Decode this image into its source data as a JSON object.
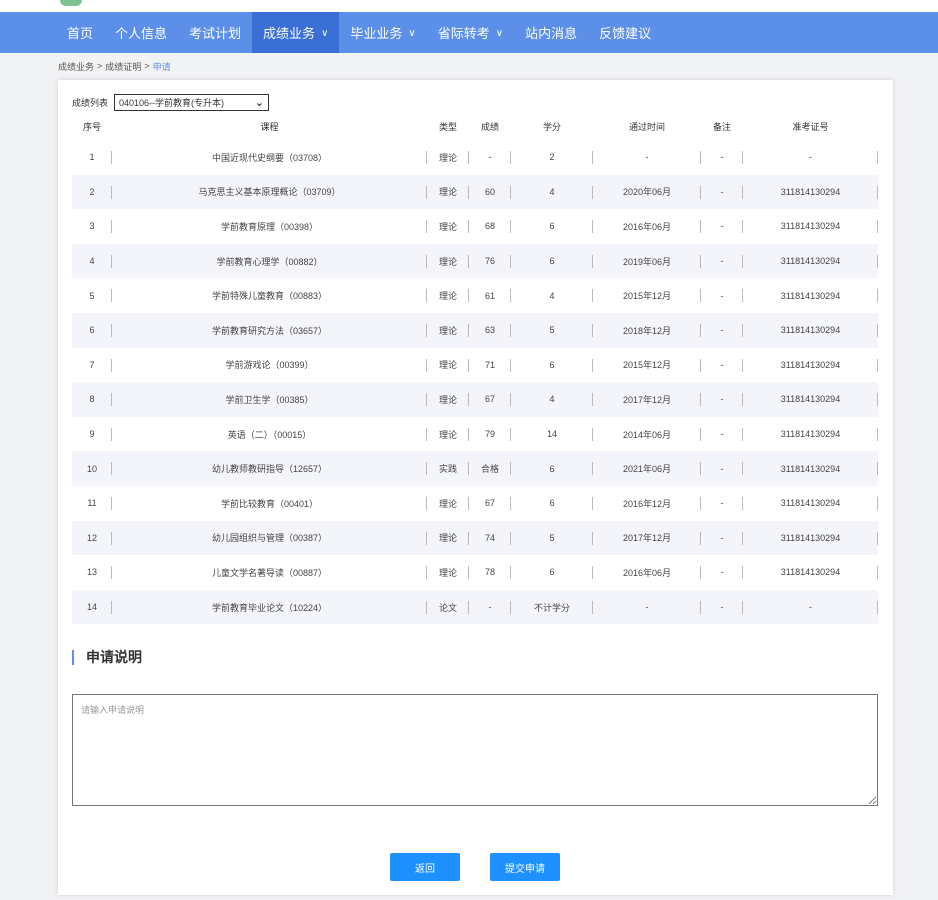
{
  "nav": {
    "items": [
      {
        "label": "首页",
        "dropdown": false,
        "active": false
      },
      {
        "label": "个人信息",
        "dropdown": false,
        "active": false
      },
      {
        "label": "考试计划",
        "dropdown": false,
        "active": false
      },
      {
        "label": "成绩业务",
        "dropdown": true,
        "active": true
      },
      {
        "label": "毕业业务",
        "dropdown": true,
        "active": false
      },
      {
        "label": "省际转考",
        "dropdown": true,
        "active": false
      },
      {
        "label": "站内消息",
        "dropdown": false,
        "active": false
      },
      {
        "label": "反馈建议",
        "dropdown": false,
        "active": false
      }
    ],
    "chevron": "∨"
  },
  "breadcrumb": {
    "items": [
      "成绩业务",
      "成绩证明"
    ],
    "current": "申请",
    "separator": ">"
  },
  "selector": {
    "label": "成绩列表",
    "value": "040106--学前教育(专升本)"
  },
  "table": {
    "headers": [
      "序号",
      "课程",
      "类型",
      "成绩",
      "学分",
      "通过时间",
      "备注",
      "准考证号"
    ],
    "rows": [
      [
        "1",
        "中国近现代史纲要（03708）",
        "理论",
        "-",
        "2",
        "-",
        "-",
        "-"
      ],
      [
        "2",
        "马克思主义基本原理概论（03709）",
        "理论",
        "60",
        "4",
        "2020年06月",
        "-",
        "311814130294"
      ],
      [
        "3",
        "学前教育原理（00398）",
        "理论",
        "68",
        "6",
        "2016年06月",
        "-",
        "311814130294"
      ],
      [
        "4",
        "学前教育心理学（00882）",
        "理论",
        "76",
        "6",
        "2019年06月",
        "-",
        "311814130294"
      ],
      [
        "5",
        "学前特殊儿童教育（00883）",
        "理论",
        "61",
        "4",
        "2015年12月",
        "-",
        "311814130294"
      ],
      [
        "6",
        "学前教育研究方法（03657）",
        "理论",
        "63",
        "5",
        "2018年12月",
        "-",
        "311814130294"
      ],
      [
        "7",
        "学前游戏论（00399）",
        "理论",
        "71",
        "6",
        "2015年12月",
        "-",
        "311814130294"
      ],
      [
        "8",
        "学前卫生学（00385）",
        "理论",
        "67",
        "4",
        "2017年12月",
        "-",
        "311814130294"
      ],
      [
        "9",
        "英语（二）（00015）",
        "理论",
        "79",
        "14",
        "2014年06月",
        "-",
        "311814130294"
      ],
      [
        "10",
        "幼儿教师教研指导（12657）",
        "实践",
        "合格",
        "6",
        "2021年06月",
        "-",
        "311814130294"
      ],
      [
        "11",
        "学前比较教育（00401）",
        "理论",
        "67",
        "6",
        "2016年12月",
        "-",
        "311814130294"
      ],
      [
        "12",
        "幼儿园组织与管理（00387）",
        "理论",
        "74",
        "5",
        "2017年12月",
        "-",
        "311814130294"
      ],
      [
        "13",
        "儿童文学名著导读（00887）",
        "理论",
        "78",
        "6",
        "2016年06月",
        "-",
        "311814130294"
      ],
      [
        "14",
        "学前教育毕业论文（10224）",
        "论文",
        "-",
        "不计学分",
        "-",
        "-",
        "-"
      ]
    ]
  },
  "application": {
    "title": "申请说明",
    "placeholder": "请输入申请说明",
    "value": ""
  },
  "buttons": {
    "back": "返回",
    "submit": "提交申请"
  },
  "colors": {
    "nav_bg": "#5b8fe8",
    "nav_active": "#3a6fd6",
    "button": "#1e90ff",
    "accent": "#5b8fe8"
  }
}
